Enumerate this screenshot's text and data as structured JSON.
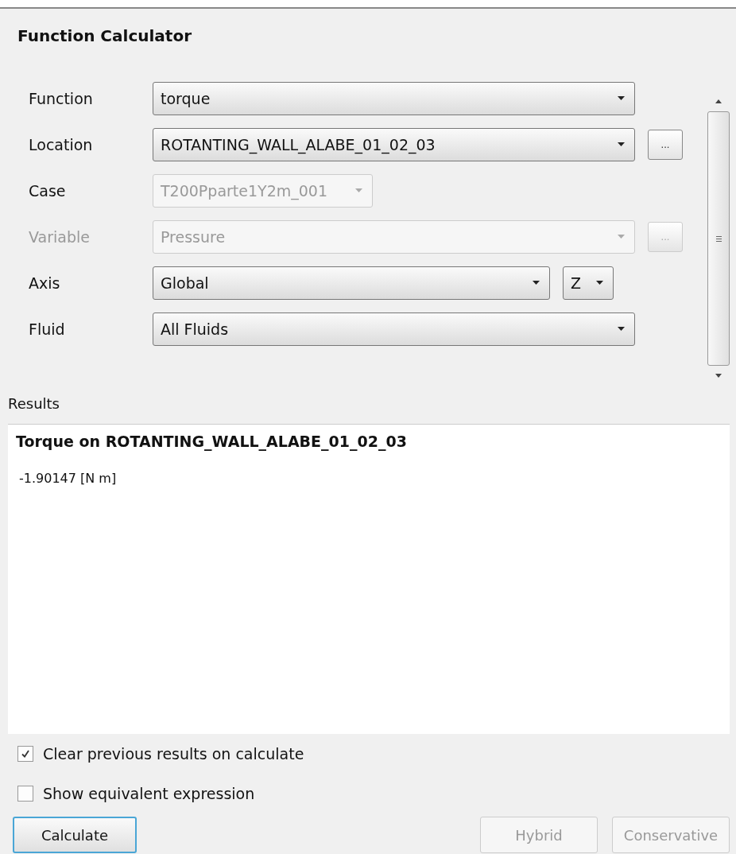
{
  "title": "Function Calculator",
  "fields": [
    {
      "label": "Function",
      "label_disabled": false,
      "kind": "wide",
      "value": "torque",
      "disabled": false
    },
    {
      "label": "Location",
      "label_disabled": false,
      "kind": "wide",
      "value": "ROTANTING_WALL_ALABE_01_02_03",
      "disabled": false,
      "button": "..."
    },
    {
      "label": "Case",
      "label_disabled": false,
      "kind": "narrow",
      "value": "T200Pparte1Y2m_001",
      "disabled": true
    },
    {
      "label": "Variable",
      "label_disabled": true,
      "kind": "wide",
      "value": "Pressure",
      "disabled": true,
      "button": "..."
    },
    {
      "label": "Axis",
      "label_disabled": false,
      "kind": "split",
      "value": "Global",
      "disabled": false,
      "extra": "Z"
    },
    {
      "label": "Fluid",
      "label_disabled": false,
      "kind": "wide",
      "value": "All Fluids",
      "disabled": false
    }
  ],
  "results": {
    "label": "Results",
    "heading": "Torque on ROTANTING_WALL_ALABE_01_02_03",
    "value": "-1.90147 [N m]"
  },
  "options": [
    {
      "label": "Clear previous results on calculate",
      "checked": true
    },
    {
      "label": "Show equivalent expression",
      "checked": false
    }
  ],
  "buttons": [
    {
      "label": "Calculate",
      "disabled": false,
      "focused": true
    },
    {
      "label": "Hybrid",
      "disabled": true,
      "focused": false
    },
    {
      "label": "Conservative",
      "disabled": true,
      "focused": false
    }
  ]
}
